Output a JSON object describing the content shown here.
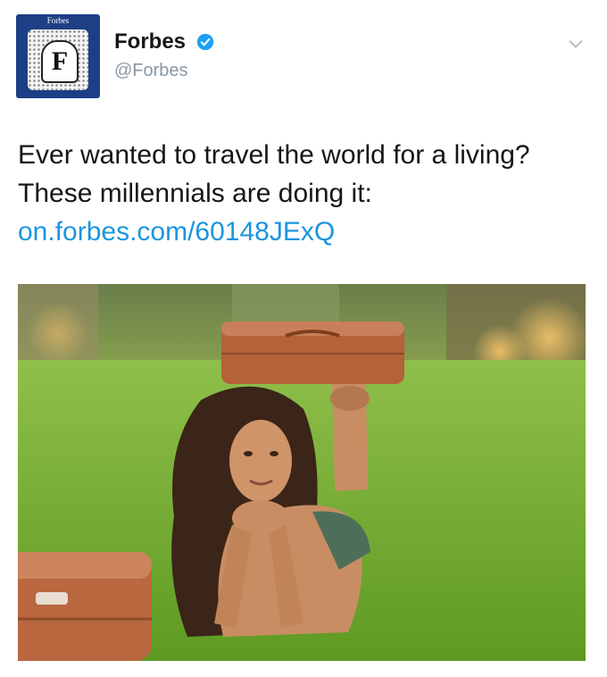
{
  "author": {
    "avatar_brand": "Forbes",
    "avatar_letter": "F",
    "display_name": "Forbes",
    "handle": "@Forbes",
    "verified": true
  },
  "tweet": {
    "text": "Ever wanted to travel the world for a living? These millennials are doing it:",
    "link": "on.forbes.com/60148JExQ"
  },
  "media": {
    "description": "Young woman lying on grass with chin on hands, feet raised balancing a brown suitcase"
  },
  "icons": {
    "verified": "verified-badge-icon",
    "menu": "chevron-down-icon"
  },
  "colors": {
    "link": "#1b95e0",
    "verified": "#1da1f2",
    "avatar_bg": "#1d3f86",
    "text": "#14171a",
    "muted": "#8899a6"
  }
}
